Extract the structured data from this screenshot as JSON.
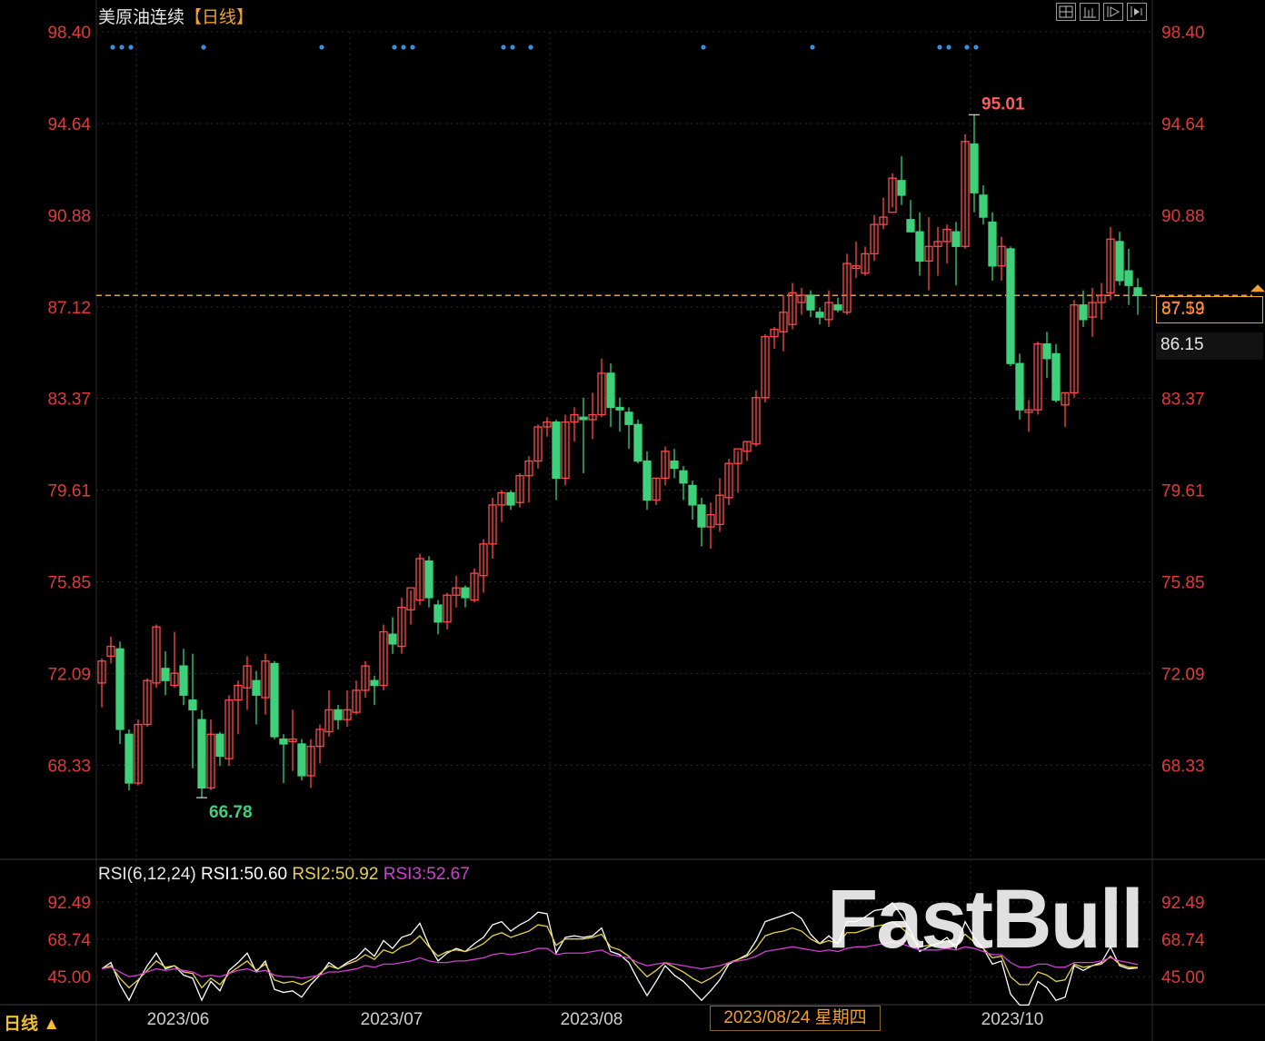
{
  "header": {
    "instrument": "美原油连续",
    "period_label": "【日线】"
  },
  "toolbar": {
    "icons": [
      "grid-layout-icon",
      "bars-indicator-icon",
      "play-forward-icon",
      "step-forward-icon"
    ]
  },
  "colors": {
    "up": "#ff4a4a",
    "down": "#3fd07a",
    "axis_label": "#e03a3a",
    "last_price_line": "#f0a030",
    "rsi1": "#ffffff",
    "rsi2": "#e6d24a",
    "rsi3": "#d040d0",
    "signal_dot": "#3a8fd8"
  },
  "rsi": {
    "label": "RSI(6,12,24)",
    "rsi1_label": "RSI1:50.60",
    "rsi2_label": "RSI2:50.92",
    "rsi3_label": "RSI3:52.67"
  },
  "footer": {
    "period_tab": "日线 ▲",
    "crosshair_date": "2023/08/24 星期四"
  },
  "price_tags": {
    "last": "87.59",
    "prev": "86.15"
  },
  "watermark": "FastBull",
  "chart_data": [
    {
      "type": "candlestick",
      "title": "美原油连续【日线】",
      "y_ticks": [
        "98.40",
        "94.64",
        "90.88",
        "87.12",
        "83.37",
        "79.61",
        "75.85",
        "72.09",
        "68.33"
      ],
      "ylim": [
        66.78,
        98.4
      ],
      "x_ticks": [
        "2023/06",
        "2023/07",
        "2023/08",
        "2023/10"
      ],
      "high_label": "95.01",
      "low_label": "66.78",
      "last_price": 87.59,
      "ohlc": [
        [
          71.7,
          72.7,
          70.7,
          72.6
        ],
        [
          72.8,
          73.6,
          72.5,
          73.2
        ],
        [
          73.1,
          73.4,
          69.2,
          69.8
        ],
        [
          69.6,
          69.8,
          67.3,
          67.6
        ],
        [
          67.6,
          70.2,
          67.5,
          70.0
        ],
        [
          70.0,
          71.9,
          69.9,
          71.8
        ],
        [
          71.7,
          74.1,
          71.5,
          74.0
        ],
        [
          72.3,
          73.0,
          71.2,
          71.8
        ],
        [
          71.6,
          73.8,
          71.5,
          72.1
        ],
        [
          72.4,
          73.1,
          70.8,
          71.2
        ],
        [
          71.0,
          72.9,
          68.2,
          70.6
        ],
        [
          70.2,
          70.6,
          67.0,
          67.4
        ],
        [
          67.4,
          70.2,
          67.3,
          69.6
        ],
        [
          69.6,
          69.7,
          68.3,
          68.7
        ],
        [
          68.6,
          71.2,
          68.3,
          71.0
        ],
        [
          71.0,
          71.8,
          69.6,
          71.6
        ],
        [
          71.5,
          72.8,
          70.6,
          72.4
        ],
        [
          71.8,
          72.2,
          70.0,
          71.2
        ],
        [
          71.1,
          72.9,
          70.4,
          72.6
        ],
        [
          72.5,
          72.6,
          69.4,
          69.5
        ],
        [
          69.4,
          69.6,
          67.6,
          69.2
        ],
        [
          69.3,
          70.6,
          68.1,
          69.4
        ],
        [
          69.2,
          69.4,
          67.7,
          67.9
        ],
        [
          67.9,
          69.4,
          67.4,
          69.1
        ],
        [
          69.1,
          70.0,
          68.4,
          69.8
        ],
        [
          69.7,
          71.4,
          69.5,
          70.6
        ],
        [
          70.6,
          70.8,
          69.8,
          70.2
        ],
        [
          70.2,
          71.4,
          69.9,
          70.6
        ],
        [
          70.5,
          71.8,
          70.4,
          71.4
        ],
        [
          71.4,
          72.6,
          71.1,
          72.4
        ],
        [
          71.8,
          72.0,
          70.8,
          71.6
        ],
        [
          71.6,
          74.1,
          71.4,
          73.8
        ],
        [
          73.7,
          74.4,
          72.9,
          73.3
        ],
        [
          73.2,
          75.2,
          72.9,
          74.8
        ],
        [
          74.7,
          75.5,
          74.1,
          75.6
        ],
        [
          75.1,
          77.0,
          74.9,
          76.8
        ],
        [
          76.7,
          76.9,
          74.8,
          75.2
        ],
        [
          74.9,
          75.1,
          73.7,
          74.2
        ],
        [
          74.2,
          75.4,
          73.9,
          75.3
        ],
        [
          75.3,
          76.1,
          74.8,
          75.6
        ],
        [
          75.6,
          75.7,
          74.8,
          75.2
        ],
        [
          75.1,
          76.4,
          75.0,
          76.2
        ],
        [
          76.1,
          77.6,
          75.4,
          77.4
        ],
        [
          77.4,
          79.3,
          76.8,
          79.0
        ],
        [
          79.0,
          79.6,
          78.3,
          79.5
        ],
        [
          79.5,
          79.6,
          78.8,
          79.0
        ],
        [
          79.1,
          80.3,
          78.9,
          80.2
        ],
        [
          80.2,
          81.0,
          79.1,
          80.8
        ],
        [
          80.8,
          82.3,
          80.5,
          82.2
        ],
        [
          82.2,
          82.6,
          81.8,
          82.4
        ],
        [
          82.4,
          82.5,
          79.2,
          80.1
        ],
        [
          80.1,
          82.7,
          79.8,
          82.4
        ],
        [
          82.4,
          83.0,
          81.6,
          82.7
        ],
        [
          82.6,
          83.4,
          80.3,
          82.5
        ],
        [
          82.5,
          83.6,
          81.7,
          82.7
        ],
        [
          82.7,
          85.0,
          82.6,
          84.4
        ],
        [
          84.4,
          84.8,
          82.2,
          83.0
        ],
        [
          83.0,
          83.4,
          82.0,
          82.9
        ],
        [
          82.8,
          83.0,
          81.3,
          82.3
        ],
        [
          82.3,
          82.5,
          80.7,
          80.8
        ],
        [
          80.8,
          81.2,
          78.8,
          79.2
        ],
        [
          79.2,
          80.1,
          79.0,
          80.1
        ],
        [
          80.1,
          81.4,
          79.8,
          81.2
        ],
        [
          80.8,
          81.3,
          80.1,
          80.5
        ],
        [
          80.4,
          80.6,
          79.2,
          79.9
        ],
        [
          79.8,
          80.0,
          78.4,
          79.0
        ],
        [
          79.0,
          79.3,
          77.3,
          78.1
        ],
        [
          78.1,
          79.1,
          77.2,
          78.6
        ],
        [
          78.2,
          80.1,
          77.9,
          79.4
        ],
        [
          79.3,
          80.9,
          79.0,
          80.7
        ],
        [
          80.7,
          81.2,
          79.5,
          81.3
        ],
        [
          81.2,
          81.6,
          80.8,
          81.6
        ],
        [
          81.5,
          83.7,
          81.4,
          83.4
        ],
        [
          83.4,
          86.0,
          83.2,
          85.9
        ],
        [
          85.9,
          86.3,
          85.4,
          86.2
        ],
        [
          86.1,
          87.6,
          85.3,
          86.9
        ],
        [
          86.4,
          88.1,
          86.2,
          87.7
        ],
        [
          87.3,
          87.9,
          86.8,
          87.6
        ],
        [
          87.6,
          87.8,
          86.7,
          87.0
        ],
        [
          86.9,
          87.1,
          86.4,
          86.7
        ],
        [
          86.6,
          87.8,
          86.3,
          87.3
        ],
        [
          87.2,
          87.5,
          86.9,
          87.0
        ],
        [
          86.9,
          89.3,
          86.8,
          88.9
        ],
        [
          88.7,
          89.8,
          88.3,
          88.8
        ],
        [
          88.5,
          89.6,
          88.4,
          89.3
        ],
        [
          89.3,
          90.9,
          89.0,
          90.5
        ],
        [
          90.5,
          91.6,
          90.3,
          90.8
        ],
        [
          91.0,
          92.6,
          91.2,
          92.4
        ],
        [
          92.3,
          93.3,
          91.3,
          91.7
        ],
        [
          90.7,
          91.5,
          90.4,
          90.2
        ],
        [
          90.2,
          91.0,
          88.4,
          89.0
        ],
        [
          89.0,
          90.8,
          87.8,
          89.6
        ],
        [
          89.6,
          90.4,
          88.4,
          89.8
        ],
        [
          89.8,
          90.5,
          88.9,
          90.3
        ],
        [
          90.2,
          90.6,
          88.0,
          89.6
        ],
        [
          89.6,
          94.2,
          89.5,
          93.9
        ],
        [
          93.8,
          95.0,
          91.0,
          91.8
        ],
        [
          91.7,
          92.1,
          90.5,
          90.8
        ],
        [
          90.6,
          91.0,
          88.2,
          88.8
        ],
        [
          88.8,
          90.0,
          88.2,
          89.6
        ],
        [
          89.5,
          89.6,
          84.7,
          84.8
        ],
        [
          84.8,
          85.2,
          82.5,
          82.9
        ],
        [
          82.8,
          83.3,
          82.0,
          82.9
        ],
        [
          82.9,
          85.7,
          82.7,
          85.6
        ],
        [
          85.6,
          86.1,
          84.2,
          85.0
        ],
        [
          85.2,
          85.6,
          83.2,
          83.3
        ],
        [
          83.1,
          83.6,
          82.2,
          83.6
        ],
        [
          83.6,
          87.4,
          83.4,
          87.2
        ],
        [
          87.2,
          87.8,
          86.3,
          86.6
        ],
        [
          86.7,
          87.9,
          85.9,
          87.3
        ],
        [
          87.3,
          88.1,
          86.6,
          87.6
        ],
        [
          87.7,
          90.4,
          87.4,
          89.9
        ],
        [
          89.8,
          90.2,
          88.0,
          88.2
        ],
        [
          88.6,
          89.5,
          87.2,
          88.0
        ],
        [
          87.9,
          88.3,
          86.8,
          87.59
        ]
      ],
      "signal_marker_indices": [
        1,
        2,
        3,
        11,
        24,
        32,
        33,
        34,
        44,
        45,
        47,
        66,
        78,
        92,
        93,
        95,
        96
      ]
    },
    {
      "type": "line",
      "title": "RSI(6,12,24)",
      "y_ticks": [
        "92.49",
        "68.74",
        "45.00"
      ],
      "ylim": [
        33,
        100
      ],
      "series": [
        {
          "name": "RSI1",
          "values": [
            50,
            54,
            40,
            30,
            42,
            52,
            60,
            50,
            52,
            46,
            44,
            30,
            42,
            36,
            49,
            54,
            60,
            48,
            55,
            37,
            35,
            36,
            32,
            40,
            46,
            54,
            50,
            54,
            57,
            63,
            58,
            68,
            63,
            70,
            72,
            79,
            65,
            55,
            60,
            63,
            61,
            66,
            70,
            78,
            80,
            74,
            78,
            81,
            86,
            85,
            60,
            70,
            71,
            70,
            71,
            76,
            61,
            59,
            54,
            43,
            33,
            42,
            52,
            46,
            42,
            36,
            30,
            36,
            43,
            53,
            56,
            59,
            68,
            80,
            82,
            84,
            86,
            82,
            72,
            66,
            71,
            66,
            80,
            80,
            83,
            87,
            88,
            92,
            84,
            74,
            61,
            64,
            66,
            70,
            63,
            80,
            70,
            63,
            53,
            55,
            34,
            27,
            27,
            42,
            38,
            30,
            32,
            52,
            49,
            52,
            54,
            64,
            52,
            50,
            50.6
          ]
        },
        {
          "name": "RSI2",
          "values": [
            50,
            52,
            44,
            38,
            43,
            49,
            55,
            51,
            52,
            48,
            47,
            38,
            44,
            40,
            47,
            51,
            55,
            49,
            53,
            43,
            41,
            42,
            40,
            43,
            47,
            52,
            50,
            53,
            55,
            59,
            56,
            62,
            60,
            64,
            66,
            71,
            64,
            58,
            61,
            62,
            61,
            63,
            66,
            71,
            73,
            70,
            72,
            74,
            78,
            77,
            65,
            69,
            69,
            69,
            70,
            72,
            64,
            62,
            58,
            51,
            45,
            49,
            54,
            51,
            48,
            44,
            41,
            44,
            48,
            54,
            56,
            58,
            63,
            71,
            73,
            74,
            76,
            74,
            69,
            66,
            68,
            66,
            73,
            73,
            75,
            77,
            78,
            80,
            76,
            71,
            64,
            65,
            66,
            68,
            65,
            72,
            67,
            63,
            57,
            58,
            45,
            40,
            40,
            48,
            46,
            42,
            43,
            53,
            51,
            52,
            53,
            58,
            53,
            51,
            50.92
          ]
        },
        {
          "name": "RSI3",
          "values": [
            50,
            51,
            48,
            45,
            46,
            48,
            50,
            49,
            50,
            49,
            48,
            45,
            46,
            45,
            47,
            49,
            50,
            48,
            49,
            46,
            45,
            45,
            44,
            45,
            46,
            48,
            48,
            49,
            50,
            52,
            51,
            53,
            53,
            54,
            55,
            57,
            55,
            54,
            54,
            55,
            55,
            56,
            57,
            59,
            60,
            59,
            60,
            61,
            63,
            63,
            59,
            60,
            60,
            60,
            61,
            62,
            59,
            58,
            57,
            54,
            52,
            53,
            54,
            53,
            52,
            51,
            50,
            51,
            52,
            54,
            55,
            56,
            58,
            61,
            62,
            63,
            64,
            63,
            62,
            61,
            62,
            61,
            63,
            64,
            64,
            65,
            66,
            67,
            66,
            64,
            62,
            62,
            62,
            63,
            62,
            64,
            63,
            61,
            59,
            59,
            54,
            51,
            51,
            53,
            53,
            51,
            51,
            54,
            54,
            54,
            55,
            57,
            55,
            54,
            52.67
          ]
        }
      ]
    }
  ]
}
